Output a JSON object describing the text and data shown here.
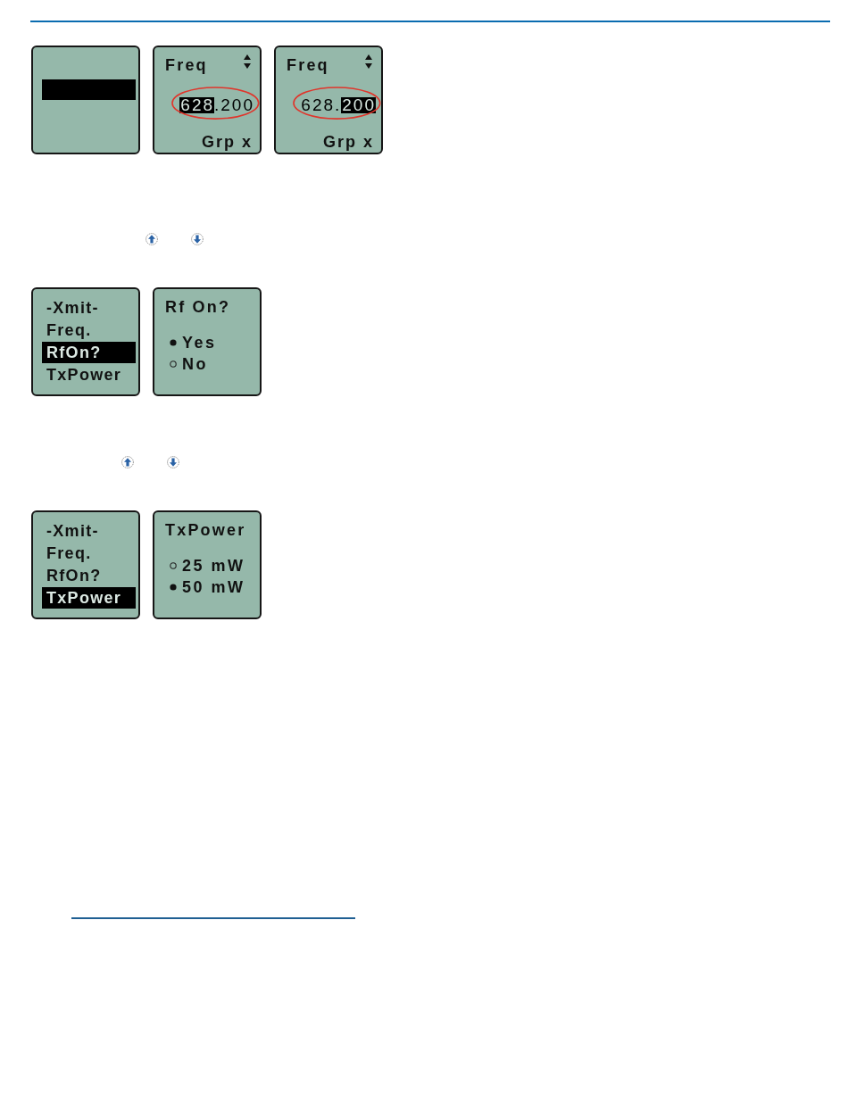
{
  "sections": [
    {
      "kind": "screens",
      "screens": [
        {
          "kind": "blank_highlight"
        },
        {
          "kind": "value",
          "title": "Freq",
          "value": [
            {
              "text": "628",
              "selected": true
            },
            {
              "text": ".200",
              "selected": false
            }
          ],
          "circled": true,
          "footer": "Grp x"
        },
        {
          "kind": "value",
          "title": "Freq",
          "value": [
            {
              "text": "628.",
              "selected": false
            },
            {
              "text": "200",
              "selected": true
            }
          ],
          "circled": true,
          "footer": "Grp x"
        }
      ]
    },
    {
      "kind": "key_hint"
    },
    {
      "kind": "screens",
      "screens": [
        {
          "kind": "menu",
          "title": "-Xmit-",
          "items": [
            {
              "label": "Freq.",
              "selected": false
            },
            {
              "label": "RfOn?",
              "selected": true
            },
            {
              "label": "TxPower",
              "selected": false
            }
          ]
        },
        {
          "kind": "options",
          "title": "Rf On?",
          "options": [
            {
              "label": "Yes",
              "selected": true
            },
            {
              "label": "No",
              "selected": false
            }
          ]
        }
      ]
    },
    {
      "kind": "key_hint"
    },
    {
      "kind": "screens",
      "screens": [
        {
          "kind": "menu",
          "title": "-Xmit-",
          "items": [
            {
              "label": "Freq.",
              "selected": false
            },
            {
              "label": "RfOn?",
              "selected": false
            },
            {
              "label": "TxPower",
              "selected": true
            }
          ]
        },
        {
          "kind": "options",
          "title": "TxPower",
          "options": [
            {
              "label": "25 mW",
              "selected": false
            },
            {
              "label": "50 mW",
              "selected": true
            }
          ]
        }
      ]
    }
  ]
}
